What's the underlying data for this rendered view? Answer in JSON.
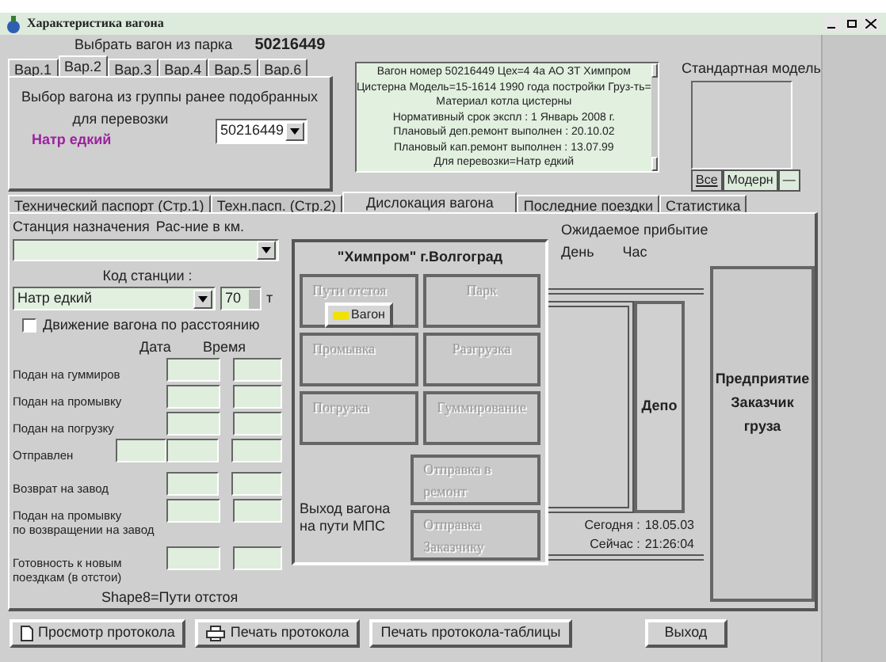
{
  "window": {
    "title": "Характеристика вагона"
  },
  "park": {
    "label": "Выбрать вагон из парка",
    "number": "50216449"
  },
  "variant_tabs": [
    {
      "label": "Вар.1",
      "selected": false
    },
    {
      "label": "Вар.2",
      "selected": true
    },
    {
      "label": "Вар.3",
      "selected": false
    },
    {
      "label": "Вар.4",
      "selected": false
    },
    {
      "label": "Вар.5",
      "selected": false
    },
    {
      "label": "Вар.6",
      "selected": false
    }
  ],
  "variant_panel": {
    "caption": "Выбор вагона из группы ранее подобранных",
    "caption_2": "для перевозки",
    "cargo": "Натр едкий",
    "wagon_select": "50216449"
  },
  "info_lines": [
    "Вагон номер 50216449   Цех=4 4а  АО ЗТ Химпром",
    "Цистерна Модель=15-1614  1990 года постройки Груз-ть=",
    "Материал котла цистерны",
    "Нормативный срок экспл : 1 Январь 2008 г.",
    "Плановый деп.ремонт выполнен : 20.10.02",
    "Плановый кап.ремонт выполнен : 13.07.99",
    "Для перевозки=Натр едкий"
  ],
  "standard_model": {
    "label": "Стандартная модель",
    "tabs": [
      {
        "label": "Все",
        "selected": true
      },
      {
        "label": "Модерн",
        "selected": false
      },
      {
        "label": "—",
        "selected": false
      }
    ]
  },
  "main_tabs": [
    {
      "label": "Технический паспорт (Стр.1)",
      "selected": false
    },
    {
      "label": "Техн.пасп. (Стр.2)",
      "selected": false
    },
    {
      "label": "Дислокация вагона",
      "selected": true
    },
    {
      "label": "Последние поездки",
      "selected": false
    },
    {
      "label": "Статистика",
      "selected": false
    }
  ],
  "left": {
    "station_label": "Станция назначения",
    "distance_label": "Рас-ние в км.",
    "station_code_label": "Код станции :",
    "cargo_select": "Натр едкий",
    "spin_value": "70",
    "spin_unit": "т",
    "movement_checkbox": {
      "label": "Движение вагона по расстоянию",
      "checked": false
    },
    "date_header": "Дата",
    "time_header": "Время",
    "rows": [
      {
        "label": "Подан на гуммиров",
        "extra_field": false
      },
      {
        "label": "Подан на промывку",
        "extra_field": false
      },
      {
        "label": "Подан на погрузку",
        "extra_field": false
      },
      {
        "label": "Отправлен",
        "extra_field": true
      },
      {
        "label": "Возврат  на завод",
        "extra_field": false
      },
      {
        "label": "Подан на промывку",
        "label_2": "по возвращении на завод",
        "extra_field": false
      },
      {
        "label": "Готовность к новым",
        "label_2": "поездкам (в отстои)",
        "extra_field": false
      }
    ],
    "note": "Shape8=Пути отстоя"
  },
  "plant": {
    "title": "\"Химпром\" г.Волгоград",
    "areas": [
      "Пути отстоя",
      "Парк",
      "Промывка",
      "Разгрузка",
      "Погрузка",
      "Гуммирование"
    ],
    "wagon_button": "Вагон",
    "exit_label": "Выход вагона на пути МПС",
    "dispatch": [
      "Отправка в ремонт",
      "Отправка Заказчику"
    ]
  },
  "arrival": {
    "label": "Ожидаемое прибытие",
    "day": "День",
    "hour": "Час"
  },
  "depot": "Депо",
  "customer": [
    "Предприятие",
    "Заказчик",
    "груза"
  ],
  "clock": [
    {
      "label": "Сегодня :",
      "value": "18.05.03"
    },
    {
      "label": "Сейчас :",
      "value": "21:26:04"
    }
  ],
  "buttons": [
    {
      "label": "Просмотр протокола",
      "kind": "view"
    },
    {
      "label": "Печать протокола",
      "kind": "print"
    },
    {
      "label": "Печать протокола-таблицы",
      "kind": "plain"
    },
    {
      "label": "Выход",
      "kind": "plain"
    }
  ]
}
